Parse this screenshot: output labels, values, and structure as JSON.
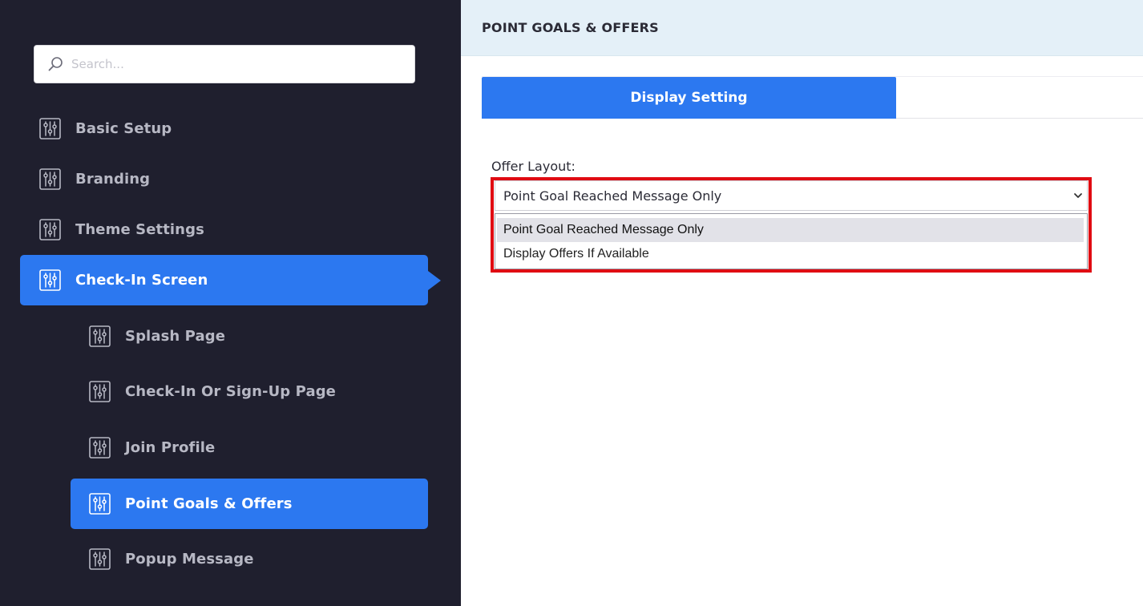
{
  "sidebar": {
    "search": {
      "placeholder": "Search..."
    },
    "items": [
      {
        "label": "Basic Setup",
        "icon": "sliders-icon"
      },
      {
        "label": "Branding",
        "icon": "sliders-icon"
      },
      {
        "label": "Theme Settings",
        "icon": "sliders-icon"
      },
      {
        "label": "Check-In Screen",
        "icon": "sliders-icon",
        "active": true
      }
    ],
    "sub_items": [
      {
        "label": "Splash Page",
        "icon": "sliders-icon"
      },
      {
        "label": "Check-In Or Sign-Up Page",
        "icon": "sliders-icon"
      },
      {
        "label": "Join Profile",
        "icon": "sliders-icon"
      },
      {
        "label": "Point Goals & Offers",
        "icon": "sliders-icon",
        "active": true
      },
      {
        "label": "Popup Message",
        "icon": "sliders-icon"
      }
    ]
  },
  "main": {
    "page_title": "POINT GOALS & OFFERS",
    "tabs": [
      {
        "label": "Display Setting",
        "active": true
      }
    ],
    "offer_layout": {
      "label": "Offer Layout:",
      "selected": "Point Goal Reached Message Only",
      "options": [
        "Point Goal Reached Message Only",
        "Display Offers If Available"
      ]
    }
  },
  "colors": {
    "sidebar_bg": "#1f1f2e",
    "accent": "#2c78f0",
    "header_bg": "#e4f0f8",
    "highlight_outline": "#e00b12"
  }
}
